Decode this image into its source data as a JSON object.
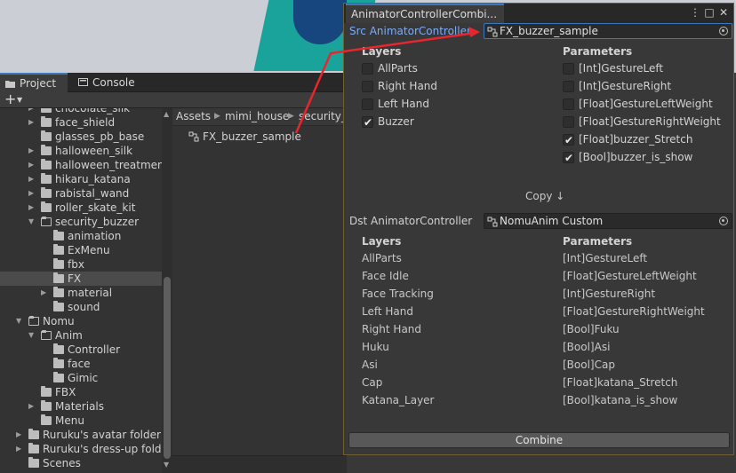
{
  "project_panel": {
    "tabs": [
      {
        "label": "Project",
        "icon": "folder-icon"
      },
      {
        "label": "Console",
        "icon": "console-icon"
      }
    ],
    "create_button": "+",
    "tree": [
      {
        "label": "chocolate_silk",
        "depth": 2,
        "expandable": true,
        "expanded": false
      },
      {
        "label": "face_shield",
        "depth": 2,
        "expandable": true,
        "expanded": false
      },
      {
        "label": "glasses_pb_base",
        "depth": 2,
        "expandable": false,
        "expanded": false
      },
      {
        "label": "halloween_silk",
        "depth": 2,
        "expandable": true,
        "expanded": false
      },
      {
        "label": "halloween_treatment",
        "depth": 2,
        "expandable": true,
        "expanded": false
      },
      {
        "label": "hikaru_katana",
        "depth": 2,
        "expandable": true,
        "expanded": false
      },
      {
        "label": "rabistal_wand",
        "depth": 2,
        "expandable": true,
        "expanded": false
      },
      {
        "label": "roller_skate_kit",
        "depth": 2,
        "expandable": true,
        "expanded": false
      },
      {
        "label": "security_buzzer",
        "depth": 2,
        "expandable": true,
        "expanded": true
      },
      {
        "label": "animation",
        "depth": 3,
        "expandable": false,
        "expanded": false
      },
      {
        "label": "ExMenu",
        "depth": 3,
        "expandable": false,
        "expanded": false
      },
      {
        "label": "fbx",
        "depth": 3,
        "expandable": false,
        "expanded": false
      },
      {
        "label": "FX",
        "depth": 3,
        "expandable": false,
        "expanded": false,
        "selected": true
      },
      {
        "label": "material",
        "depth": 3,
        "expandable": true,
        "expanded": false
      },
      {
        "label": "sound",
        "depth": 3,
        "expandable": false,
        "expanded": false
      },
      {
        "label": "Nomu",
        "depth": 1,
        "expandable": true,
        "expanded": true
      },
      {
        "label": "Anim",
        "depth": 2,
        "expandable": true,
        "expanded": true
      },
      {
        "label": "Controller",
        "depth": 3,
        "expandable": false,
        "expanded": false
      },
      {
        "label": "face",
        "depth": 3,
        "expandable": false,
        "expanded": false
      },
      {
        "label": "Gimic",
        "depth": 3,
        "expandable": false,
        "expanded": false
      },
      {
        "label": "FBX",
        "depth": 2,
        "expandable": false,
        "expanded": false
      },
      {
        "label": "Materials",
        "depth": 2,
        "expandable": true,
        "expanded": false
      },
      {
        "label": "Menu",
        "depth": 2,
        "expandable": false,
        "expanded": false
      },
      {
        "label": "Ruruku's avatar folder",
        "depth": 1,
        "expandable": true,
        "expanded": false
      },
      {
        "label": "Ruruku's dress-up folde",
        "depth": 1,
        "expandable": true,
        "expanded": false
      },
      {
        "label": "Scenes",
        "depth": 1,
        "expandable": false,
        "expanded": false
      }
    ],
    "breadcrumb": [
      "Assets",
      "mimi_house",
      "security_"
    ],
    "files": [
      {
        "label": "FX_buzzer_sample",
        "icon": "animator-controller-icon"
      }
    ]
  },
  "window": {
    "title": "AnimatorControllerCombi...",
    "src": {
      "label": "Src AnimatorController",
      "value": "FX_buzzer_sample"
    },
    "src_layers_header": "Layers",
    "src_params_header": "Parameters",
    "src_layers": [
      {
        "label": "AllParts",
        "checked": false
      },
      {
        "label": "Right Hand",
        "checked": false
      },
      {
        "label": "Left Hand",
        "checked": false
      },
      {
        "label": "Buzzer",
        "checked": true
      }
    ],
    "src_params": [
      {
        "label": "[Int]GestureLeft",
        "checked": false
      },
      {
        "label": "[Int]GestureRight",
        "checked": false
      },
      {
        "label": "[Float]GestureLeftWeight",
        "checked": false
      },
      {
        "label": "[Float]GestureRightWeight",
        "checked": false
      },
      {
        "label": "[Float]buzzer_Stretch",
        "checked": true
      },
      {
        "label": "[Bool]buzzer_is_show",
        "checked": true
      }
    ],
    "copy_label": "Copy ↓",
    "dst": {
      "label": "Dst AnimatorController",
      "value": "NomuAnim Custom"
    },
    "dst_layers_header": "Layers",
    "dst_params_header": "Parameters",
    "dst_layers": [
      "AllParts",
      "Face Idle",
      "Face Tracking",
      "Left Hand",
      "Right Hand",
      "Huku",
      "Asi",
      "Cap",
      "Katana_Layer"
    ],
    "dst_params": [
      "[Int]GestureLeft",
      "[Float]GestureLeftWeight",
      "[Int]GestureRight",
      "[Float]GestureRightWeight",
      "[Bool]Fuku",
      "[Bool]Asi",
      "[Bool]Cap",
      "[Float]katana_Stretch",
      "[Bool]katana_is_show"
    ],
    "combine_label": "Combine"
  },
  "colors": {
    "annotation_arrow": "#e8262e",
    "accent": "#3a79bb",
    "src_label": "#7cacf8"
  }
}
